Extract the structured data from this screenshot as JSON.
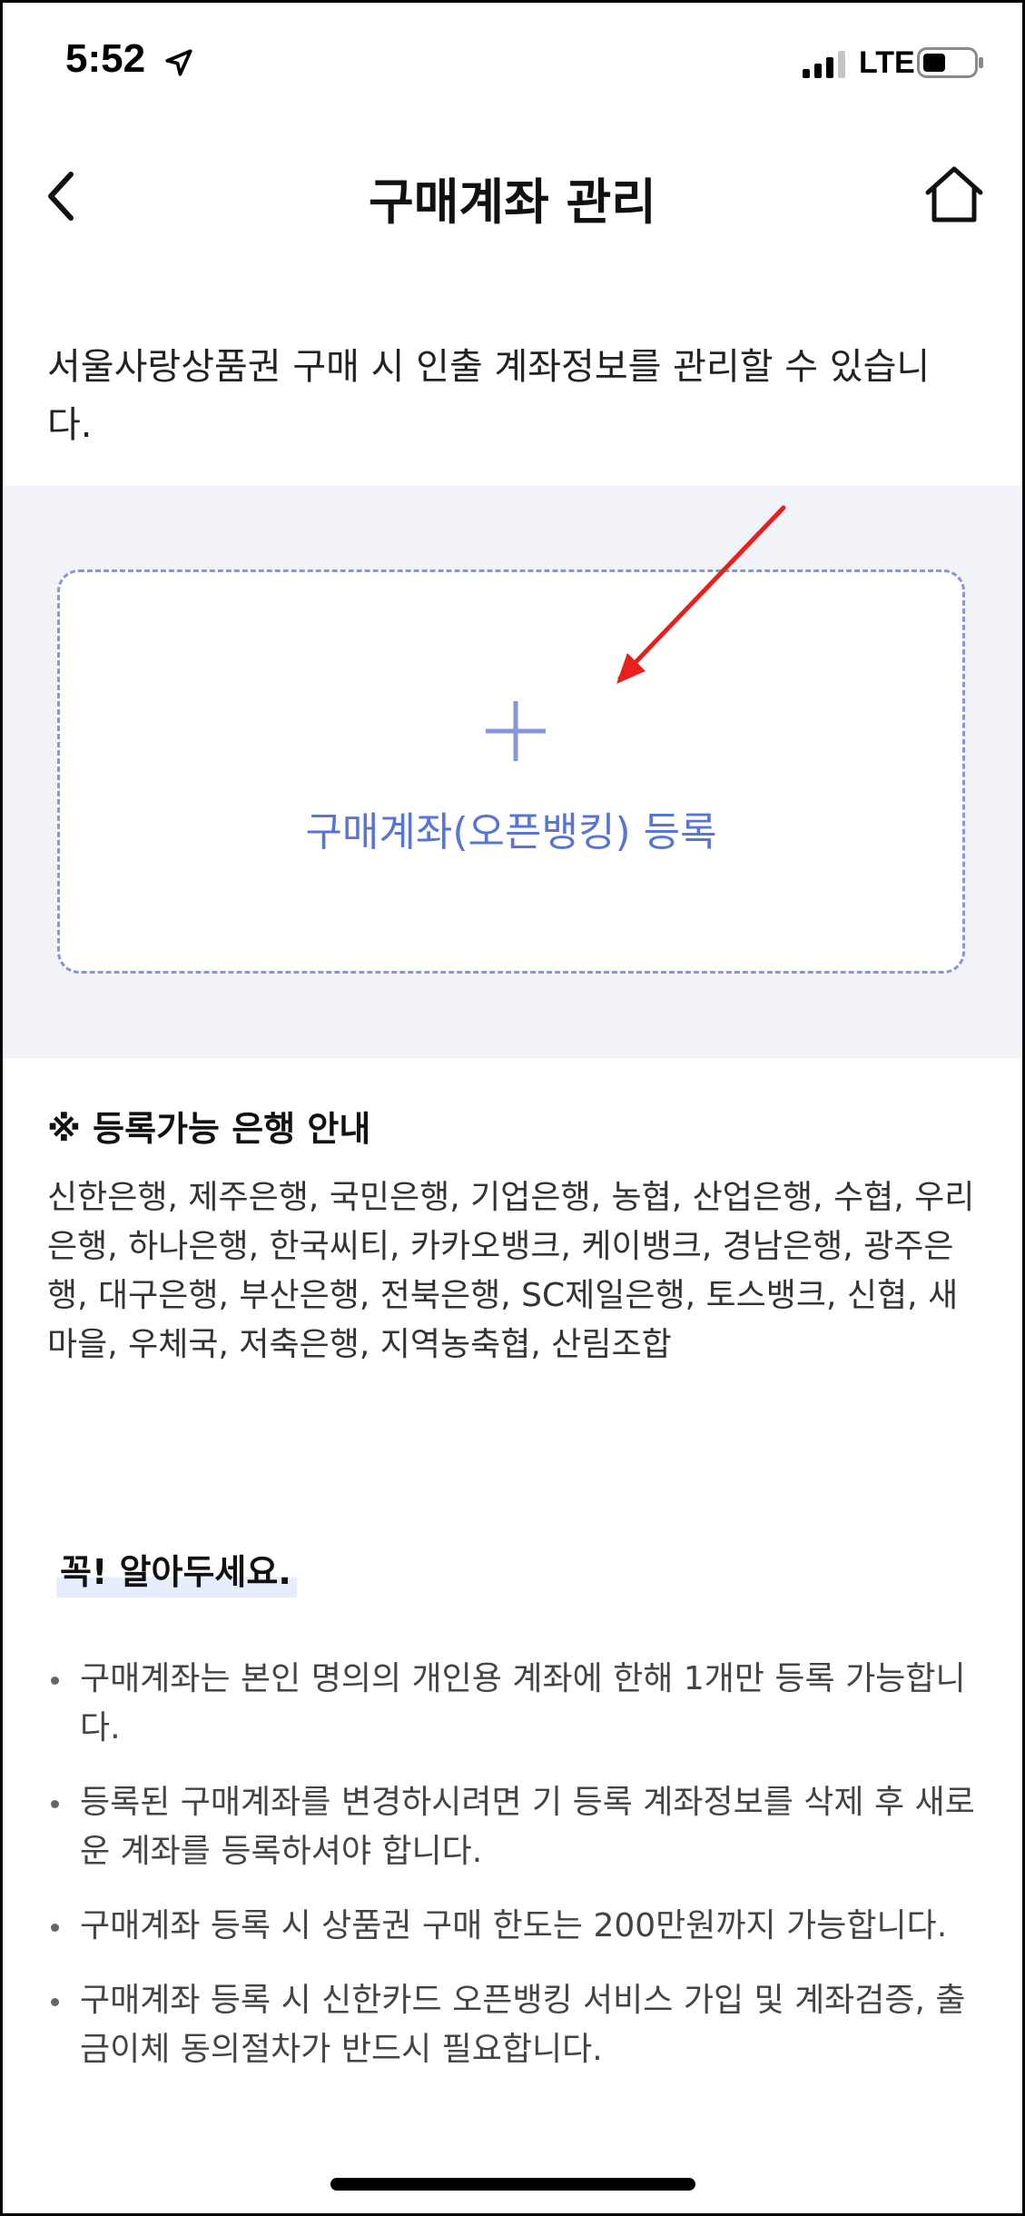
{
  "status_bar": {
    "time": "5:52",
    "network": "LTE"
  },
  "header": {
    "title": "구매계좌 관리"
  },
  "description": "서울사랑상품권 구매 시 인출 계좌정보를 관리할 수 있습니다.",
  "register": {
    "label": "구매계좌(오픈뱅킹) 등록"
  },
  "banks": {
    "title": "※ 등록가능 은행 안내",
    "list": "신한은행, 제주은행, 국민은행, 기업은행, 농협, 산업은행, 수협, 우리은행, 하나은행, 한국씨티, 카카오뱅크, 케이뱅크, 경남은행, 광주은행, 대구은행, 부산은행, 전북은행, SC제일은행, 토스뱅크, 신협, 새마을, 우체국, 저축은행, 지역농축협, 산림조합"
  },
  "notice": {
    "title": "꼭! 알아두세요.",
    "items": [
      "구매계좌는 본인 명의의 개인용 계좌에 한해 1개만 등록 가능합니다.",
      "등록된 구매계좌를 변경하시려면 기 등록 계좌정보를 삭제 후 새로운 계좌를 등록하셔야 합니다.",
      "구매계좌 등록 시 상품권 구매 한도는 200만원까지 가능합니다.",
      "구매계좌 등록 시 신한카드 오픈뱅킹 서비스 가입 및 계좌검증, 출금이체 동의절차가 반드시 필요합니다."
    ]
  },
  "colors": {
    "accent": "#5875d6",
    "dashed_border": "#8796d8",
    "section_bg": "#f1f3f8",
    "annotation_arrow": "#e8201c"
  }
}
